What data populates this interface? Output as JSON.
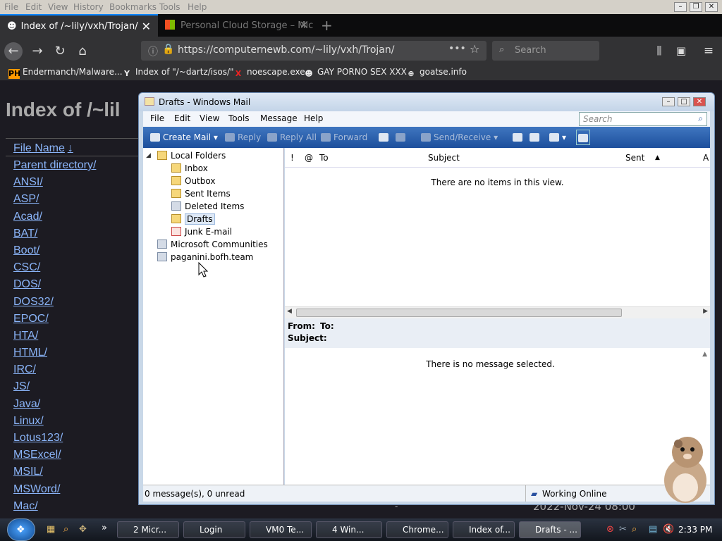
{
  "browser": {
    "menu": [
      "File",
      "Edit",
      "View",
      "History",
      "Bookmarks",
      "Tools",
      "Help"
    ],
    "tabs": [
      {
        "title": "Index of /~lily/vxh/Trojan/"
      },
      {
        "title": "Personal Cloud Storage – Mic"
      }
    ],
    "url": "https://computernewb.com/~lily/vxh/Trojan/",
    "search_placeholder": "Search",
    "bookmarks": [
      {
        "icon": "PH",
        "label": "Endermanch/Malware..."
      },
      {
        "icon": "Y",
        "label": "Index of \"/~dartz/isos/\""
      },
      {
        "icon": "X",
        "label": "noescape.exe"
      },
      {
        "icon": "☻",
        "label": "GAY PORNO SEX XXX"
      },
      {
        "icon": "⊕",
        "label": "goatse.info"
      }
    ]
  },
  "page": {
    "heading": "Index of /~lil",
    "column_header": "File Name",
    "sort_arrow": "↓",
    "entries": [
      "Parent directory/",
      "ANSI/",
      "ASP/",
      "Acad/",
      "BAT/",
      "Boot/",
      "CSC/",
      "DOS/",
      "DOS32/",
      "EPOC/",
      "HTA/",
      "HTML/",
      "IRC/",
      "JS/",
      "Java/",
      "Linux/",
      "Lotus123/",
      "MSExcel/",
      "MSIL/",
      "MSWord/",
      "Mac/"
    ],
    "date_fragment": "2022-Nov-24 08:00",
    "dash": "-"
  },
  "mail": {
    "title": "Drafts - Windows Mail",
    "menu": [
      "File",
      "Edit",
      "View",
      "Tools",
      "Message",
      "Help"
    ],
    "search_placeholder": "Search",
    "toolbar": {
      "create_mail": "Create Mail",
      "reply": "Reply",
      "reply_all": "Reply All",
      "forward": "Forward",
      "send_receive": "Send/Receive"
    },
    "folders": {
      "root": "Local Folders",
      "items": [
        "Inbox",
        "Outbox",
        "Sent Items",
        "Deleted Items",
        "Drafts",
        "Junk E-mail"
      ],
      "selected": "Drafts",
      "other": [
        "Microsoft Communities",
        "paganini.bofh.team"
      ]
    },
    "list_columns": {
      "flag": "!",
      "attach": "@",
      "to": "To",
      "subject": "Subject",
      "sent": "Sent",
      "more": "A"
    },
    "empty_text": "There are no items in this view.",
    "preview": {
      "from": "From:",
      "to": "To:",
      "subject": "Subject:",
      "empty": "There is no message selected."
    },
    "status_left": "0 message(s), 0 unread",
    "status_right": "Working Online"
  },
  "taskbar": {
    "items": [
      "2 Micr...",
      "Login",
      "VM0 Te...",
      "4 Win...",
      "Chrome...",
      "Index of...",
      "Drafts - ..."
    ],
    "overflow": "»",
    "clock": "2:33 PM"
  }
}
